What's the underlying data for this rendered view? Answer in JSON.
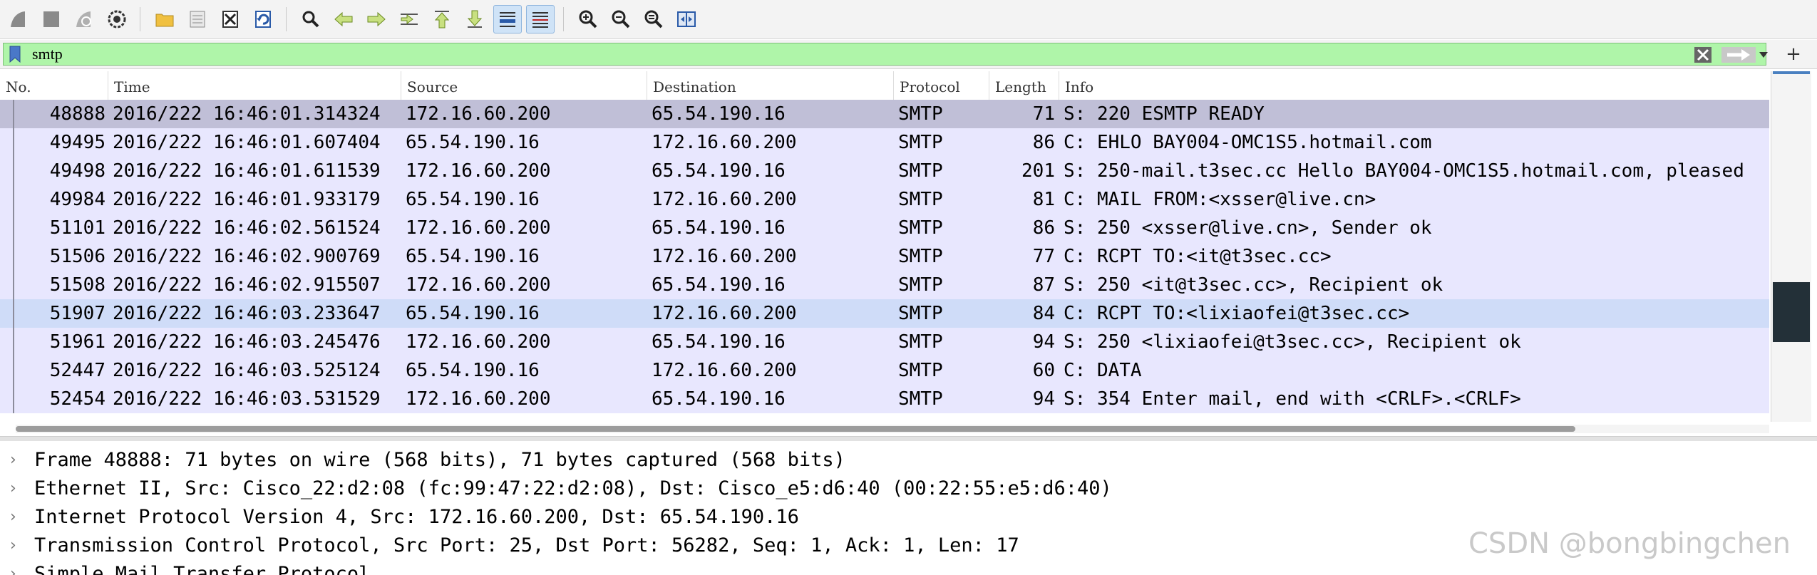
{
  "toolbar": {
    "buttons": [
      {
        "name": "start-capture-icon"
      },
      {
        "name": "stop-capture-icon"
      },
      {
        "name": "restart-capture-icon"
      },
      {
        "name": "capture-options-icon"
      },
      {
        "name": "open-file-icon"
      },
      {
        "name": "save-file-icon"
      },
      {
        "name": "close-file-icon"
      },
      {
        "name": "reload-file-icon"
      },
      {
        "name": "find-packet-icon"
      },
      {
        "name": "go-back-icon"
      },
      {
        "name": "go-forward-icon"
      },
      {
        "name": "go-to-packet-icon"
      },
      {
        "name": "first-packet-icon"
      },
      {
        "name": "last-packet-icon"
      },
      {
        "name": "autoscroll-icon"
      },
      {
        "name": "colorize-icon"
      },
      {
        "name": "zoom-in-icon"
      },
      {
        "name": "zoom-out-icon"
      },
      {
        "name": "zoom-reset-icon"
      },
      {
        "name": "resize-columns-icon"
      }
    ]
  },
  "filter": {
    "value": "smtp",
    "plus_label": "+"
  },
  "packet_list": {
    "columns": [
      "No.",
      "Time",
      "Source",
      "Destination",
      "Protocol",
      "Length",
      "Info"
    ],
    "rows": [
      {
        "no": "48888",
        "time": "2016/222 16:46:01.314324",
        "src": "172.16.60.200",
        "dst": "65.54.190.16",
        "proto": "SMTP",
        "len": "71",
        "info": "S: 220 ESMTP READY"
      },
      {
        "no": "49495",
        "time": "2016/222 16:46:01.607404",
        "src": "65.54.190.16",
        "dst": "172.16.60.200",
        "proto": "SMTP",
        "len": "86",
        "info": "C: EHLO BAY004-OMC1S5.hotmail.com"
      },
      {
        "no": "49498",
        "time": "2016/222 16:46:01.611539",
        "src": "172.16.60.200",
        "dst": "65.54.190.16",
        "proto": "SMTP",
        "len": "201",
        "info": "S: 250-mail.t3sec.cc Hello BAY004-OMC1S5.hotmail.com, pleased"
      },
      {
        "no": "49984",
        "time": "2016/222 16:46:01.933179",
        "src": "65.54.190.16",
        "dst": "172.16.60.200",
        "proto": "SMTP",
        "len": "81",
        "info": "C: MAIL FROM:<xsser@live.cn>"
      },
      {
        "no": "51101",
        "time": "2016/222 16:46:02.561524",
        "src": "172.16.60.200",
        "dst": "65.54.190.16",
        "proto": "SMTP",
        "len": "86",
        "info": "S: 250 <xsser@live.cn>, Sender ok"
      },
      {
        "no": "51506",
        "time": "2016/222 16:46:02.900769",
        "src": "65.54.190.16",
        "dst": "172.16.60.200",
        "proto": "SMTP",
        "len": "77",
        "info": "C: RCPT TO:<it@t3sec.cc>"
      },
      {
        "no": "51508",
        "time": "2016/222 16:46:02.915507",
        "src": "172.16.60.200",
        "dst": "65.54.190.16",
        "proto": "SMTP",
        "len": "87",
        "info": "S: 250 <it@t3sec.cc>, Recipient ok"
      },
      {
        "no": "51907",
        "time": "2016/222 16:46:03.233647",
        "src": "65.54.190.16",
        "dst": "172.16.60.200",
        "proto": "SMTP",
        "len": "84",
        "info": "C: RCPT TO:<lixiaofei@t3sec.cc>"
      },
      {
        "no": "51961",
        "time": "2016/222 16:46:03.245476",
        "src": "172.16.60.200",
        "dst": "65.54.190.16",
        "proto": "SMTP",
        "len": "94",
        "info": "S: 250 <lixiaofei@t3sec.cc>, Recipient ok"
      },
      {
        "no": "52447",
        "time": "2016/222 16:46:03.525124",
        "src": "65.54.190.16",
        "dst": "172.16.60.200",
        "proto": "SMTP",
        "len": "60",
        "info": "C: DATA"
      },
      {
        "no": "52454",
        "time": "2016/222 16:46:03.531529",
        "src": "172.16.60.200",
        "dst": "65.54.190.16",
        "proto": "SMTP",
        "len": "94",
        "info": "S: 354 Enter mail, end with <CRLF>.<CRLF>"
      }
    ]
  },
  "details": {
    "rows": [
      "Frame 48888: 71 bytes on wire (568 bits), 71 bytes captured (568 bits)",
      "Ethernet II, Src: Cisco_22:d2:08 (fc:99:47:22:d2:08), Dst: Cisco_e5:d6:40 (00:22:55:e5:d6:40)",
      "Internet Protocol Version 4, Src: 172.16.60.200, Dst: 65.54.190.16",
      "Transmission Control Protocol, Src Port: 25, Dst Port: 56282, Seq: 1, Ack: 1, Len: 17",
      "Simple Mail Transfer Protocol"
    ],
    "arrow": "›"
  },
  "watermark": "CSDN @bongbingchen",
  "colors": {
    "filter_valid": "#aff5a9",
    "row_default": "#e8e7fe",
    "row_selected": "#c0bfd7",
    "row_highlight": "#cfdcf8"
  }
}
